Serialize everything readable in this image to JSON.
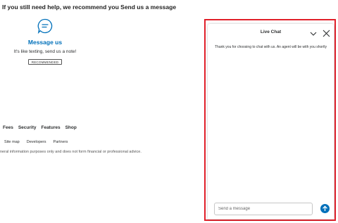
{
  "help": {
    "heading": "If you still need help, we recommend you Send us a message"
  },
  "message_card": {
    "icon": "chat-bubble-icon",
    "title": "Message us",
    "description": "It's like texting, send us a note!",
    "badge": "RECOMMENDED"
  },
  "footer": {
    "links": [
      "Fees",
      "Security",
      "Features",
      "Shop"
    ],
    "sub_links": [
      "Site map",
      "Developers",
      "Partners"
    ],
    "disclaimer": "neral information purposes only and does not form financial or professional advice."
  },
  "live_chat": {
    "title": "Live Chat",
    "minimize_icon": "chevron-down-icon",
    "close_icon": "close-icon",
    "message": "Thank you for choosing to chat with us. An agent will be with you shortly",
    "input_placeholder": "Send a message",
    "send_icon": "arrow-up-icon"
  },
  "colors": {
    "accent": "#0070ba",
    "highlight_border": "#e0202a"
  }
}
